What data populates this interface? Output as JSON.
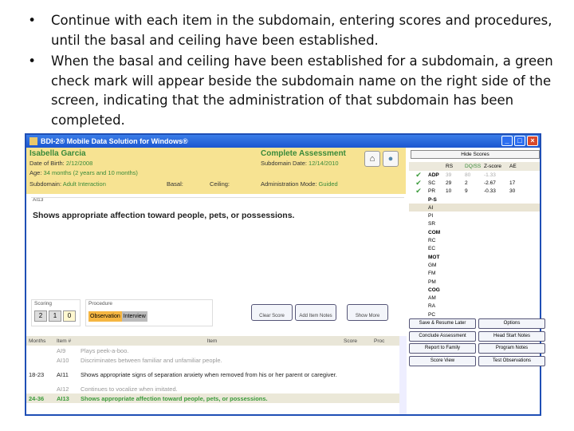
{
  "bullets": [
    "Continue with each item in the subdomain, entering scores and procedures, until the basal and ceiling have been established.",
    "When the basal and ceiling have been established for a subdomain, a green check mark will appear beside the subdomain name on the right side of the screen, indicating that the administration of that subdomain has been completed."
  ],
  "window": {
    "title": "BDI-2® Mobile Data Solution for Windows®"
  },
  "header": {
    "name": "Isabella Garcia",
    "dob_label": "Date of Birth:",
    "dob": "2/12/2008",
    "age_label": "Age:",
    "age": "34 months (2 years and 10 months)",
    "subdomain_label": "Subdomain:",
    "subdomain": "Adult Interaction",
    "basal_label": "Basal:",
    "ceiling_label": "Ceiling:",
    "mode": "Complete Assessment",
    "subdate_label": "Subdomain Date:",
    "subdate": "12/14/2010",
    "admin_label": "Administration Mode:",
    "admin": "Guided"
  },
  "item": {
    "id": "AI13",
    "text": "Shows appropriate affection toward people, pets, or possessions."
  },
  "scoring": {
    "label": "Scoring",
    "buttons": [
      "2",
      "1",
      "0"
    ]
  },
  "procedure": {
    "label": "Procedure",
    "observation": "Observation",
    "interview": "Interview"
  },
  "tools": [
    "Clear Score",
    "Add Item Notes",
    "Show More"
  ],
  "grid": {
    "headers": [
      "Months",
      "Item #",
      "Item",
      "Score",
      "Proc"
    ],
    "rows": [
      {
        "months": "",
        "id": "AI9",
        "text": "Plays peek-a-boo.",
        "style": "gray"
      },
      {
        "months": "",
        "id": "AI10",
        "text": "Discriminates between familiar and unfamiliar people.",
        "style": "gray"
      },
      {
        "months": "18-23",
        "id": "AI11",
        "text": "Shows appropriate signs of separation anxiety when removed from his or her parent or caregiver.",
        "style": "black"
      },
      {
        "months": "",
        "id": "AI12",
        "text": "Continues to vocalize when imitated.",
        "style": "gray"
      },
      {
        "months": "24-36",
        "id": "AI13",
        "text": "Shows appropriate affection toward people, pets, or possessions.",
        "style": "green"
      }
    ]
  },
  "right": {
    "hide_scores": "Hide Scores",
    "headers": [
      "RS",
      "DQ/SS",
      "Z-score",
      "AE"
    ],
    "rows": [
      {
        "check": true,
        "label": "ADP",
        "rs": "39",
        "ss": "80",
        "z": "-1.33",
        "ae": "",
        "bold": true
      },
      {
        "check": true,
        "label": "SC",
        "rs": "29",
        "ss": "2",
        "z": "-2.67",
        "ae": "17"
      },
      {
        "check": true,
        "label": "PR",
        "rs": "10",
        "ss": "9",
        "z": "-0.33",
        "ae": "30"
      },
      {
        "label": "P-S",
        "bold": true
      },
      {
        "label": "AI",
        "sel": true
      },
      {
        "label": "PI"
      },
      {
        "label": "SR"
      },
      {
        "label": "COM",
        "bold": true
      },
      {
        "label": "RC"
      },
      {
        "label": "EC"
      },
      {
        "label": "MOT",
        "bold": true
      },
      {
        "label": "GM"
      },
      {
        "label": "FM"
      },
      {
        "label": "PM"
      },
      {
        "label": "COG",
        "bold": true
      },
      {
        "label": "AM"
      },
      {
        "label": "RA"
      },
      {
        "label": "PC"
      }
    ],
    "buttons": [
      "Save & Resume Later",
      "Options",
      "Conclude Assessment",
      "Head Start Notes",
      "Report to Family",
      "Program Notes",
      "Score View",
      "Test Observations"
    ]
  },
  "colors": {
    "accent": "#3a8a3a",
    "header_bg": "#f7e392",
    "titlebar": "#1c56d0"
  }
}
